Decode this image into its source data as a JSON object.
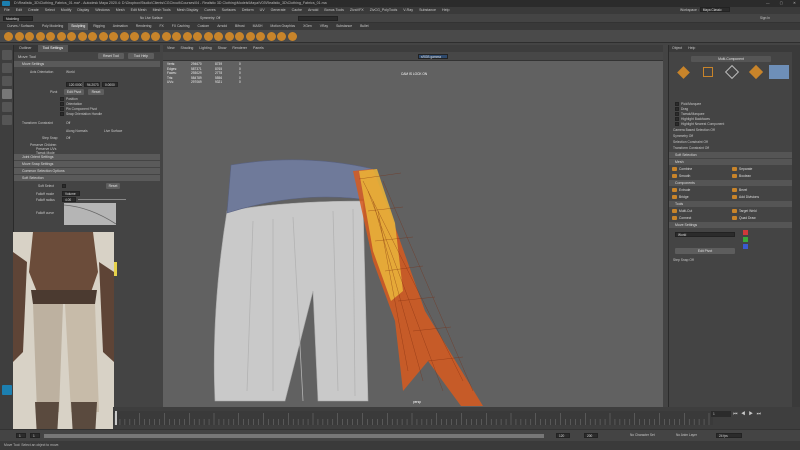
{
  "app": {
    "title": "D:\\Realistic_3D\\Clothing_Fabrics_01.ma* - Autodesk Maya 2020.4: D:\\Dropbox\\Studio\\Clients\\CGCircuit\\Courses\\04 - Realistic 3D Clothing\\Models\\Maya\\V03\\Realistic_3D\\Clothing_Fabrics_01.ma",
    "workspace_label": "Workspace :",
    "workspace_value": "Maya Classic"
  },
  "menubar": [
    "File",
    "Edit",
    "Create",
    "Select",
    "Modify",
    "Display",
    "Windows",
    "Mesh",
    "Edit Mesh",
    "Mesh Tools",
    "Mesh Display",
    "Curves",
    "Surfaces",
    "Deform",
    "UV",
    "Generate",
    "Cache",
    "Arnold",
    "Bonus Tools",
    "ZivaVFX",
    "ZivCG_PolyTools",
    "V-Ray",
    "Substance",
    "Help"
  ],
  "status_line": {
    "mode": "Modeling",
    "no_live_surface": "No Live Surface",
    "symmetry": "Symmetry: Off",
    "quick_select": "",
    "sign_in": "Sign In"
  },
  "shelf_tabs": [
    "Curves / Surfaces",
    "Poly Modeling",
    "Sculpting",
    "Rigging",
    "Animation",
    "Rendering",
    "FX",
    "FX Caching",
    "Custom",
    "Arnold",
    "Bifrost",
    "MASH",
    "Motion Graphics",
    "XGen",
    "VRay",
    "Substance",
    "Bullet"
  ],
  "shelf_active_tab": "Sculpting",
  "tool_settings": {
    "tabs": [
      "Outliner",
      "Tool Settings"
    ],
    "active_tab": "Tool Settings",
    "tool_name": "Move Tool",
    "reset_tool": "Reset Tool",
    "tool_help": "Tool Help",
    "sections": {
      "move_settings": "Move Settings",
      "axis_orientation_label": "Axis Orientation",
      "axis_orientation_value": "World",
      "values": [
        "120.0000",
        "94.2073",
        "0.0000"
      ],
      "pivot_label": "Pivot",
      "edit_pivot": "Edit Pivot",
      "reset": "Reset",
      "checks": [
        "Position",
        "Orientation",
        "Pin Component Pivot",
        "Snap Orientation Handle"
      ],
      "transform_constraint_label": "Transform Constraint",
      "transform_constraint_value": "Off",
      "along_normals": "Along Normals",
      "live_surface": "Live Surface",
      "step_snap_label": "Step Snap",
      "step_snap_value": "Off",
      "preserve_children": "Preserve Children",
      "preserve_uvs": "Preserve UVs",
      "tweak_mode": "Tweak Mode",
      "joint_orient": "Joint Orient Settings",
      "move_snap": "Move Snap Settings",
      "common_selection": "Common Selection Options",
      "soft_selection": "Soft Selection",
      "soft_select_label": "Soft Select",
      "reset_btn": "Reset",
      "falloff_mode_label": "Falloff mode",
      "falloff_mode_value": "Volume",
      "falloff_radius_label": "Falloff radius",
      "falloff_radius_value": "4.00",
      "falloff_curve_label": "Falloff curve"
    }
  },
  "viewport": {
    "menu": [
      "View",
      "Shading",
      "Lighting",
      "Show",
      "Renderer",
      "Panels"
    ],
    "hud": [
      {
        "label": "Verts:",
        "a": "294670",
        "b": "8739",
        "c": "0"
      },
      {
        "label": "Edges:",
        "a": "587371",
        "b": "8765",
        "c": "0"
      },
      {
        "label": "Faces:",
        "a": "293029",
        "b": "2778",
        "c": "0"
      },
      {
        "label": "Tris:",
        "a": "584789",
        "b": "5556",
        "c": "0"
      },
      {
        "label": "UVs:",
        "a": "297069",
        "b": "9321",
        "c": "0"
      }
    ],
    "camera_label": "persp",
    "cam_lock": "CAM IS LOCK ON",
    "colorspace": "sRGB gamma"
  },
  "modeling_toolkit": {
    "menu": [
      "Object",
      "Help"
    ],
    "title": "Multi-Component",
    "options": [
      "Pick/Marquee",
      "Drag",
      "Tweak/Marquee",
      "Highlight Backfaces",
      "Highlight Nearest Component"
    ],
    "camera_based_label": "Camera Based Selection",
    "camera_based_value": "Off",
    "symmetry_label": "Symmetry",
    "symmetry_value": "Off",
    "selection_constraint_label": "Selection Constraint",
    "selection_constraint_value": "Off",
    "transform_constraint_label": "Transform Constraint",
    "transform_constraint_value": "Off",
    "soft_selection": "Soft Selection",
    "mesh_head": "Mesh",
    "mesh_tools": [
      "Combine",
      "Separate",
      "Smooth",
      "Boolean"
    ],
    "components_head": "Components",
    "component_tools": [
      "Extrude",
      "Bevel",
      "Bridge",
      "Add Divisions"
    ],
    "tools_head": "Tools",
    "tools": [
      "Multi-Cut",
      "Target Weld",
      "Connect",
      "Quad Draw"
    ],
    "move_settings_head": "Move Settings",
    "move_space": "World",
    "edit_pivot": "Edit Pivot",
    "step_snap_label": "Step Snap",
    "step_snap_value": "Off"
  },
  "timeline": {
    "current_frame": "1",
    "range_start": "1",
    "range_start_inner": "1",
    "range_end_inner": "120",
    "range_end": "200",
    "fps": "24 fps",
    "no_character": "No Character Set",
    "no_anim_layer": "No Anim Layer"
  },
  "help_line": "Move Tool: Select an object to move.",
  "colors": {
    "accent_orange": "#c8842a",
    "pants": "#c9c9c9",
    "belt": "#6f7a9a",
    "sash": "#d85a1e"
  }
}
